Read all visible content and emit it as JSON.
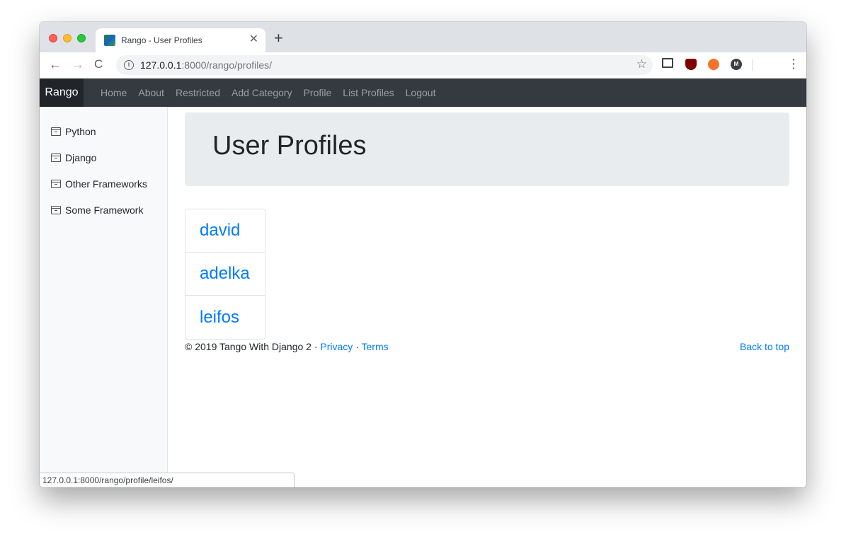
{
  "browser": {
    "tab_title": "Rango - User Profiles",
    "tab_close": "✕",
    "new_tab": "+",
    "url_host": "127.0.0.1",
    "url_rest": ":8000/rango/profiles/",
    "back": "←",
    "forward": "→",
    "reload": "C",
    "star": "☆",
    "menu": "⋮",
    "ext_m_label": "M",
    "info": "i",
    "status_url": "127.0.0.1:8000/rango/profile/leifos/"
  },
  "navbar": {
    "brand": "Rango",
    "links": [
      "Home",
      "About",
      "Restricted",
      "Add Category",
      "Profile",
      "List Profiles",
      "Logout"
    ]
  },
  "sidebar": {
    "items": [
      "Python",
      "Django",
      "Other Frameworks",
      "Some Framework"
    ]
  },
  "main": {
    "heading": "User Profiles",
    "profiles": [
      "david",
      "adelka",
      "leifos"
    ]
  },
  "footer": {
    "copyright": "© 2019 Tango With Django 2 · ",
    "privacy": "Privacy",
    "sep": " · ",
    "terms": "Terms",
    "back_to_top": "Back to top"
  },
  "colors": {
    "navbar_bg": "#343a40",
    "link_blue": "#007bff",
    "jumbotron_bg": "#e9ecef"
  }
}
